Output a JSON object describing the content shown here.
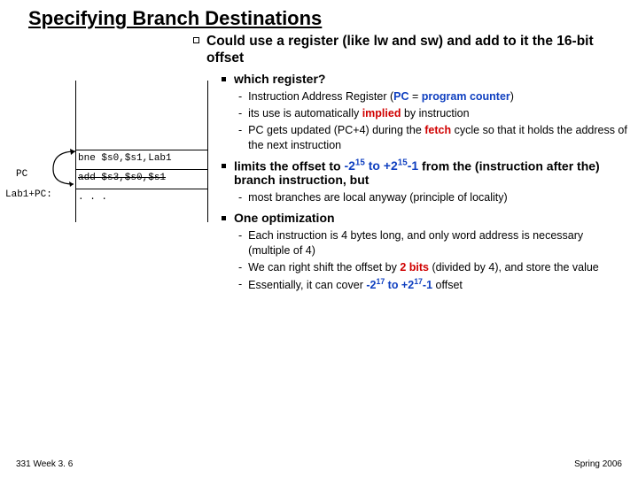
{
  "title": "Specifying Branch Destinations",
  "main_point": "Could use a register (like lw and sw) and add to it the 16-bit offset",
  "l1": {
    "which": "which register?",
    "which_items": {
      "a_pre": "Instruction Address Register  (",
      "a_pc": "PC",
      "a_eq": " = ",
      "a_prog": "program counter",
      "a_post": ")",
      "b_pre": "its use is automatically ",
      "b_imp": "implied",
      "b_post": " by instruction",
      "c_pre": "PC gets updated (PC+4) during the ",
      "c_fetch": "fetch",
      "c_post": " cycle so that it holds the address of the next instruction"
    },
    "limits_pre": "limits the offset to ",
    "limits_range": "-2<sup>15</sup> to +2<sup>15</sup>-1",
    "limits_post": "  from the (instruction after the) branch instruction, but",
    "limits_sub": "most branches are local anyway (principle of locality)",
    "opt": "One optimization",
    "opt_items": {
      "a_pre": "Each instruction is 4 bytes long,  and only word address is necessary (multiple of 4)",
      "b_pre": "We can right shift the offset by ",
      "b_bits": "2 bits",
      "b_post": " (divided by 4), and store the value",
      "c_pre": "Essentially, it can cover ",
      "c_range": "-2<sup>17</sup> to +2<sup>17</sup>-1",
      "c_post": " offset"
    }
  },
  "diagram": {
    "pc": "PC",
    "lab": "Lab1+PC:",
    "code1": "bne $s0,$s1,Lab1",
    "code2": "add $s3,$s0,$s1",
    "code3": ". . ."
  },
  "footer": {
    "left": "331 Week 3. 6",
    "right": "Spring 2006"
  }
}
